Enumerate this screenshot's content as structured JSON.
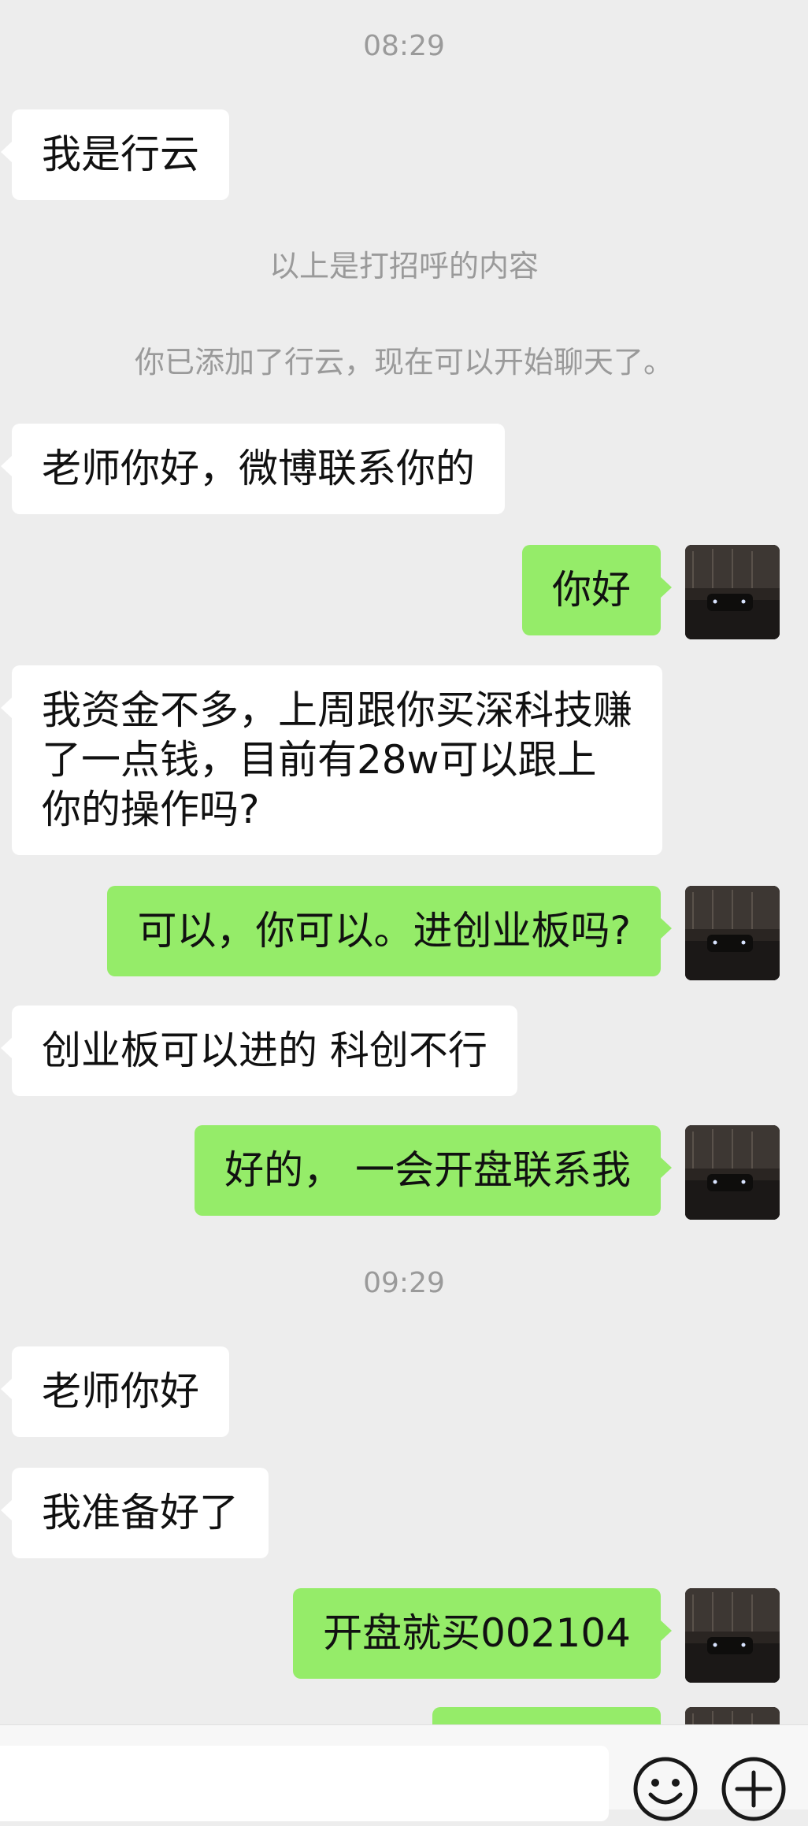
{
  "chat": {
    "timestamps": [
      "08:29",
      "09:29"
    ],
    "system": {
      "greeting_note": "以上是打招呼的内容",
      "added_note": "你已添加了行云，现在可以开始聊天了。"
    },
    "messages": [
      {
        "from": "contact",
        "text": "我是行云"
      },
      {
        "from": "contact",
        "text": "老师你好，微博联系你的"
      },
      {
        "from": "me",
        "text": "你好"
      },
      {
        "from": "contact",
        "text": "我资金不多，上周跟你买深科技赚了一点钱，目前有28w可以跟上你的操作吗?"
      },
      {
        "from": "me",
        "text": "可以，你可以。进创业板吗?"
      },
      {
        "from": "contact",
        "text": "创业板可以进的 科创不行"
      },
      {
        "from": "me",
        "text": "好的， 一会开盘联系我"
      },
      {
        "from": "contact",
        "text": "老师你好"
      },
      {
        "from": "contact",
        "text": "我准备好了"
      },
      {
        "from": "me",
        "text": "开盘就买002104"
      },
      {
        "from": "me",
        "text": ""
      }
    ]
  },
  "bottom_bar": {
    "input_value": "",
    "icons": [
      "emoji-icon",
      "plus-icon"
    ]
  },
  "colors": {
    "background": "#ededed",
    "incoming_bubble": "#ffffff",
    "outgoing_bubble": "#95ec69",
    "system_text": "#9a9a9a"
  }
}
